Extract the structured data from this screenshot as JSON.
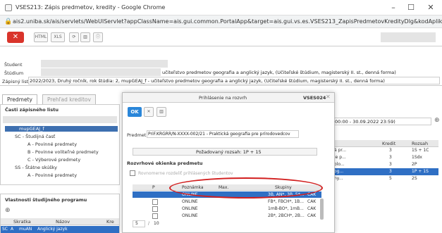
{
  "browser": {
    "title": "VSES213: Zápis predmetov, kredity - Google Chrome",
    "url": "ais2.uniba.sk/ais/servlets/WebUIServlet?appClassName=ais.gui.common.PortalApp&target=ais.gui.vs.es.VSES213_ZapisPredmetovKredityDlg&kodAplikacie=Por..."
  },
  "header": {
    "student_label": "Študent",
    "studium_label": "Štúdium",
    "studium_value": "učiteľstvo predmetov geografia a anglický jazyk, (Učiteľské štúdium, magisterský II. st., denná forma)",
    "zapisny_label": "Zápisný list",
    "zapisny_value": "2022/2023, Druhý ročník, rok štúdia: 2, mupGEAJ_f - učiteľstvo predmetov geografia a anglický jazyk, (Učiteľské štúdium, magisterský II. st., denná forma)"
  },
  "tabs": [
    "Predmety",
    "Prehľad kreditov"
  ],
  "left": {
    "section_title": "Časti zápisného listu",
    "tree": [
      "mupGEAJ_f",
      "SC - Študijná časť",
      "A - Povinné predmety",
      "B - Povinne voliteľné predmety",
      "C - Výberové predmety",
      "SS - Štátne skúšky",
      "A - Povinné predmety"
    ],
    "bottom_title": "Vlastnosti študijného programu",
    "bottom_cols": [
      "Skratka",
      "Názov",
      "Kre"
    ],
    "bottom_row": [
      "SC",
      "A",
      "muAN",
      "Anglický jazyk"
    ]
  },
  "right": {
    "date_range": "00:00 - 30.09.2022 23:59)",
    "cols": [
      "Kredit",
      "Rozsah"
    ],
    "rows": [
      {
        "name": "á pr...",
        "kredit": "3",
        "rozsah": "1S + 1C"
      },
      {
        "name": "ie p...",
        "kredit": "3",
        "rozsah": "1Sdx"
      },
      {
        "name": "olo...",
        "kredit": "3",
        "rozsah": "2P"
      },
      {
        "name": "og...",
        "kredit": "3",
        "rozsah": "1P + 1S"
      },
      {
        "name": "ny...",
        "kredit": "5",
        "rozsah": "2S"
      }
    ]
  },
  "modal": {
    "title": "Prihlásenie na rozvrh",
    "code": "VSES024",
    "ok": "OK",
    "predmet_label": "Predmet",
    "predmet_value": "PriF.KRGRR/N-XXXX-002/21 - Praktická geografia pre prírodovedcov",
    "rozsah": "Požadovaný rozsah: 1P + 15",
    "section": "Rozvrhové okienka predmetu",
    "checkbox_label": "Rovnomerne rozdeliť prihlásených študentov",
    "cols": [
      "P",
      "Poznámka",
      "Max.",
      "Skupiny"
    ],
    "rows": [
      {
        "poz": "ONLINE",
        "sk": "3B, AN*, 3B, 5*...",
        "cap": "CAK"
      },
      {
        "poz": "ONLINE",
        "sk": "FB*, FBCH*, 1B...",
        "cap": "CAK"
      },
      {
        "poz": "ONLINE",
        "sk": "1mB-BO*, 1mB...",
        "cap": "CAK"
      },
      {
        "poz": "ONLINE",
        "sk": "2B*, 2BCH*, 2B...",
        "cap": "CAK"
      }
    ],
    "pager": "5",
    "pager_total": "10"
  }
}
